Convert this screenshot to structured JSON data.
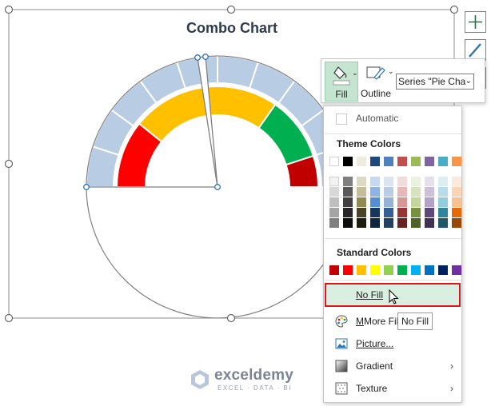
{
  "chart": {
    "title": "Combo Chart"
  },
  "toolbar": {
    "fill_label": "Fill",
    "outline_label": "Outline",
    "series_value": "Series \"Pie Cha"
  },
  "menu": {
    "automatic_label": "Automatic",
    "theme_colors_heading": "Theme Colors",
    "standard_colors_heading": "Standard Colors",
    "no_fill_label": "No Fill",
    "more_fill_label": "More Fill C",
    "picture_label": "Picture...",
    "gradient_label": "Gradient",
    "texture_label": "Texture"
  },
  "tooltip": {
    "text": "No Fill"
  },
  "brand": {
    "name": "exceldemy",
    "tagline": "EXCEL · DATA · BI"
  },
  "colors": {
    "outer_band": "#b8cce4",
    "red": "#ff0000",
    "yellow": "#ffc000",
    "green": "#00b050",
    "dark_red": "#c00000",
    "accent_green": "#217346",
    "selection_border": "#e0151a"
  },
  "theme_palette": [
    [
      "#ffffff",
      "#000000",
      "#eeece1",
      "#1f497d",
      "#4f81bd",
      "#c0504d",
      "#9bbb59",
      "#8064a2",
      "#4bacc6",
      "#f79646"
    ],
    [
      "#f2f2f2",
      "#7f7f7f",
      "#ddd9c3",
      "#c6d9f0",
      "#dbe5f1",
      "#f2dcdb",
      "#ebf1dd",
      "#e5e0ec",
      "#dbeef3",
      "#fdeada"
    ],
    [
      "#d8d8d8",
      "#595959",
      "#c4bd97",
      "#8db3e2",
      "#b8cce4",
      "#e5b9b7",
      "#d7e3bc",
      "#ccc1d9",
      "#b7dde8",
      "#fbd5b5"
    ],
    [
      "#bfbfbf",
      "#3f3f3f",
      "#938953",
      "#548dd4",
      "#95b3d7",
      "#d99694",
      "#c3d69b",
      "#b2a2c7",
      "#92cddc",
      "#fac08f"
    ],
    [
      "#a5a5a5",
      "#262626",
      "#494429",
      "#17365d",
      "#366092",
      "#953734",
      "#76923c",
      "#5f497a",
      "#31859b",
      "#e36c09"
    ],
    [
      "#7f7f7f",
      "#0c0c0c",
      "#1d1b10",
      "#0f243e",
      "#244061",
      "#632423",
      "#4f6128",
      "#3f3151",
      "#205867",
      "#974806"
    ]
  ],
  "standard_palette": [
    "#c00000",
    "#ff0000",
    "#ffc000",
    "#ffff00",
    "#92d050",
    "#00b050",
    "#00b0f0",
    "#0070c0",
    "#002060",
    "#7030a0"
  ]
}
